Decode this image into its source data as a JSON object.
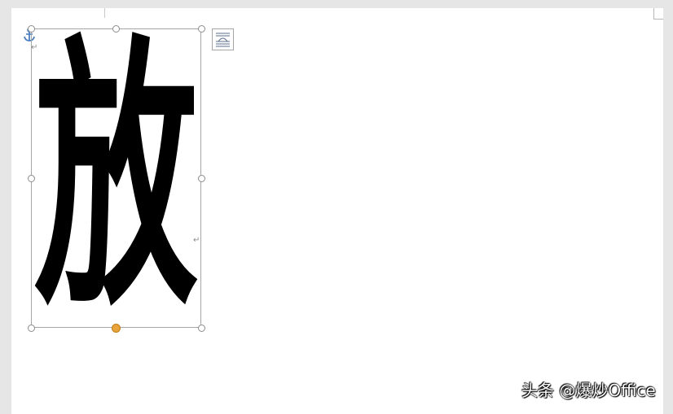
{
  "document": {
    "textbox": {
      "character": "放"
    },
    "paragraph_mark": "↵"
  },
  "icons": {
    "anchor": "anchor-icon",
    "layout_options": "layout-options-icon"
  },
  "colors": {
    "background": "#e6e6e6",
    "page": "#ffffff",
    "handle_border": "#8c8c8c",
    "rotate_handle": "#e8a33a",
    "anchor": "#4a7fc1"
  },
  "watermark": {
    "text": "头条 @爆炒Office"
  }
}
